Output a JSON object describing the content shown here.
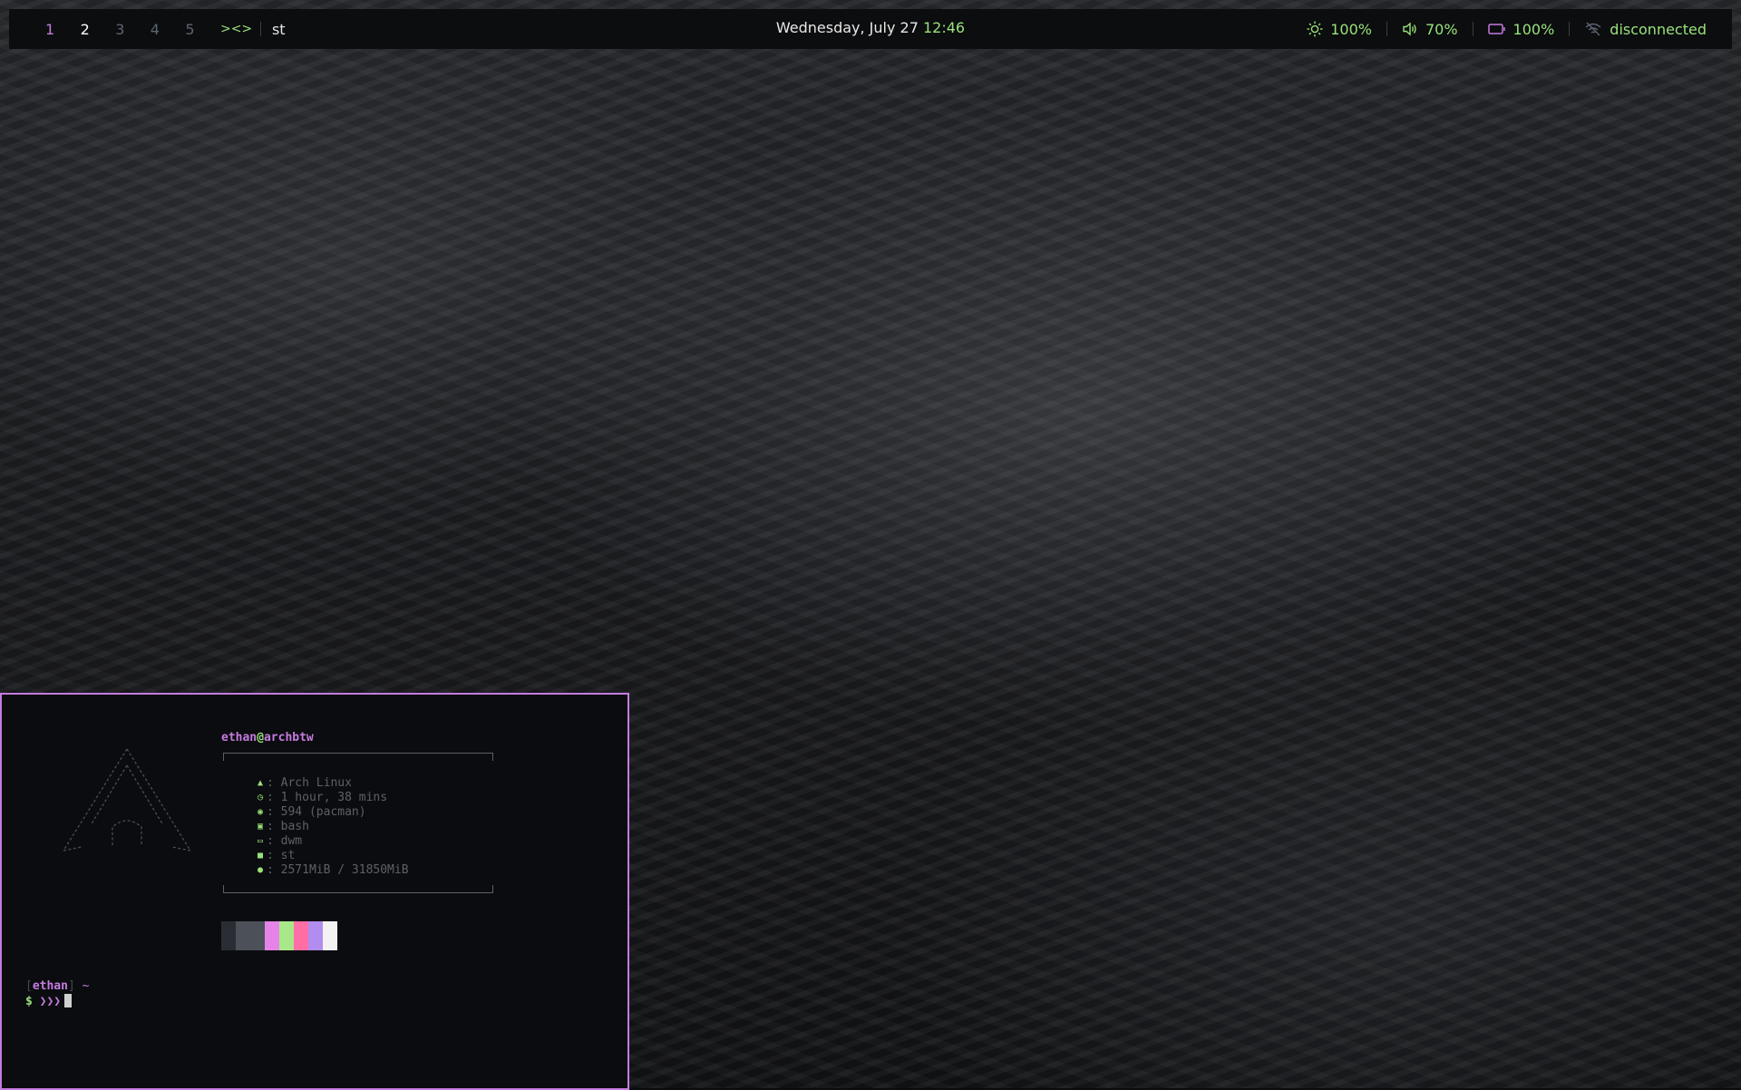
{
  "bar": {
    "workspaces": [
      {
        "label": "1",
        "state": "occupied"
      },
      {
        "label": "2",
        "state": "active"
      },
      {
        "label": "3",
        "state": "empty"
      },
      {
        "label": "4",
        "state": "empty"
      },
      {
        "label": "5",
        "state": "empty"
      }
    ],
    "layout_symbol": "><>",
    "window_title": "st",
    "date": "Wednesday, July 27",
    "time": "12:46",
    "brightness": "100%",
    "volume": "70%",
    "battery": "100%",
    "network": "disconnected",
    "colors": {
      "accent_green": "#98e37a",
      "accent_purple": "#c57be0"
    }
  },
  "terminal": {
    "user": "ethan",
    "at": "@",
    "host": "archbtw",
    "info": [
      {
        "icon": "arch-icon",
        "text": ": Arch Linux"
      },
      {
        "icon": "uptime-icon",
        "text": ": 1 hour, 38 mins"
      },
      {
        "icon": "packages-icon",
        "text": ": 594 (pacman)"
      },
      {
        "icon": "shell-icon",
        "text": ": bash"
      },
      {
        "icon": "wm-icon",
        "text": ": dwm"
      },
      {
        "icon": "terminal-icon",
        "text": ": st"
      },
      {
        "icon": "memory-icon",
        "text": ": 2571MiB / 31850MiB"
      }
    ],
    "palette": [
      "#2a2d33",
      "#4b5059",
      "#4b5059",
      "#e583e8",
      "#a9e88a",
      "#ff6fa6",
      "#b38cf0",
      "#f2f2f2"
    ],
    "prompt_user": "ethan",
    "prompt_dir": "~",
    "prompt_symbol": "$",
    "prompt_arrows": "❯❯❯"
  }
}
